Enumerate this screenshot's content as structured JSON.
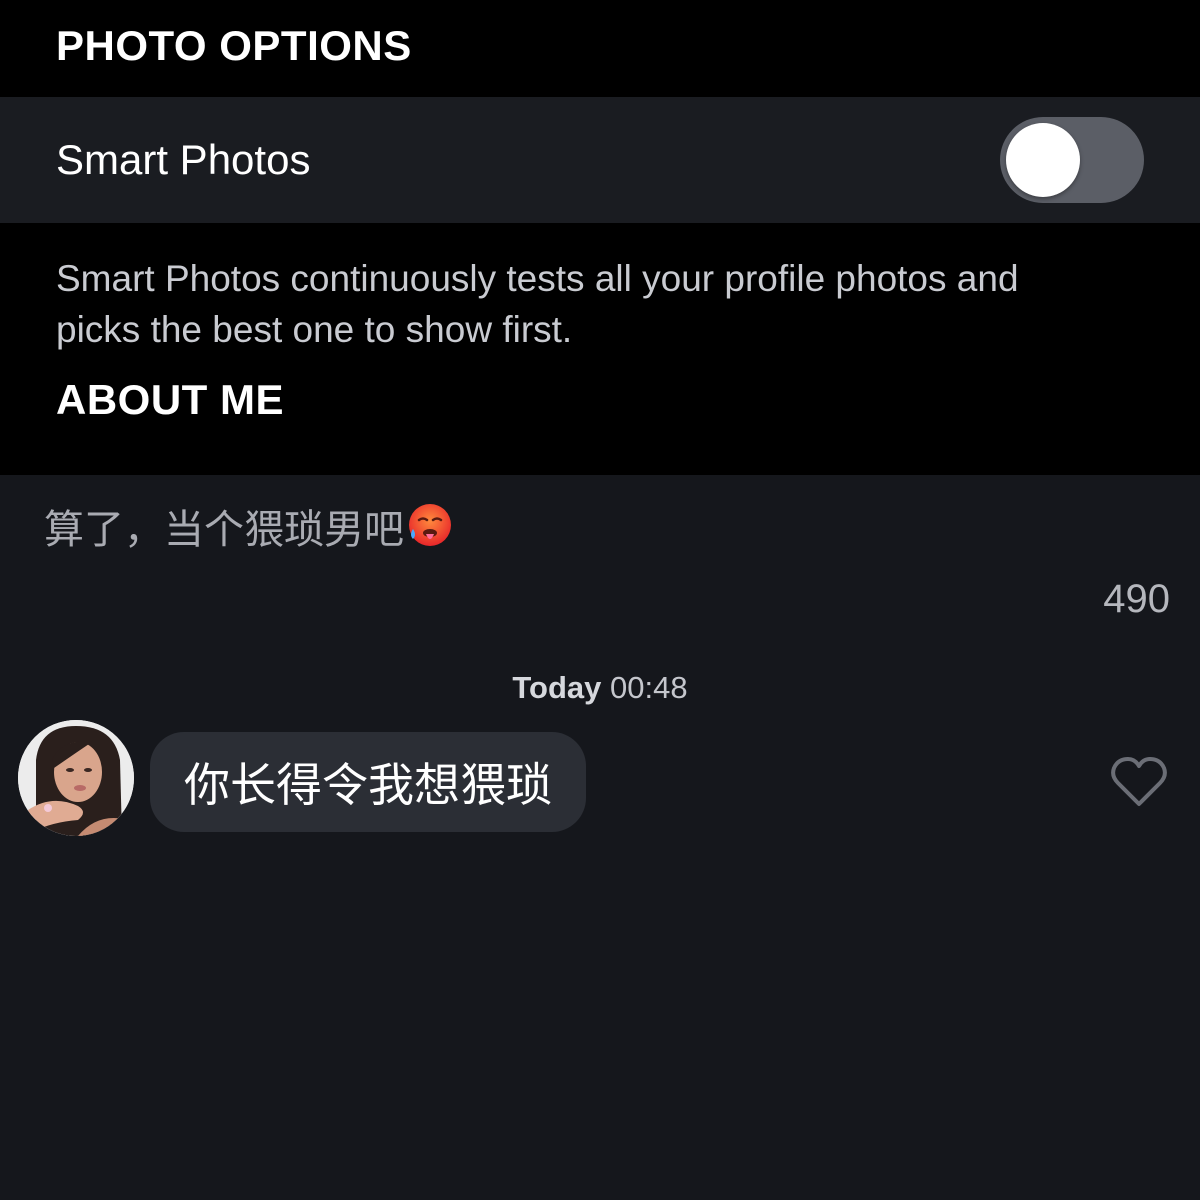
{
  "photo_options": {
    "header": "PHOTO OPTIONS",
    "smart_photos_label": "Smart Photos",
    "smart_photos_enabled": false,
    "description": "Smart Photos continuously tests all your profile photos and picks the best one to show first."
  },
  "about_me": {
    "header": "ABOUT ME",
    "bio_text": "算了，当个猥琐男吧",
    "bio_emoji": "hot-face-icon",
    "char_count": "490"
  },
  "chat": {
    "timestamp_day": "Today",
    "timestamp_time": "00:48",
    "avatar": "avatar",
    "message": "你长得令我想猥琐",
    "like_icon": "heart-icon"
  },
  "colors": {
    "background": "#15171c",
    "header_bg": "#000000",
    "row_bg": "#1a1c21",
    "bubble_bg": "#2b2e35",
    "toggle_off": "#5b5e66"
  }
}
